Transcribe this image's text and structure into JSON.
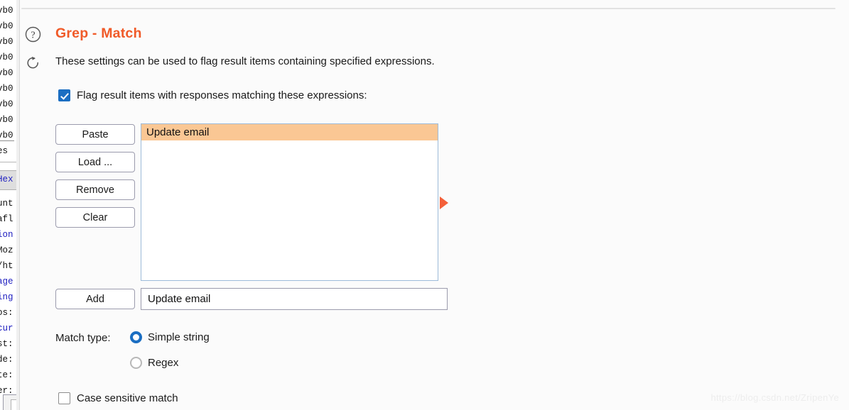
{
  "panel": {
    "title": "Grep - Match",
    "title_color": "#f05a28",
    "description": "These settings can be used to flag result items containing specified expressions.",
    "help_icon": "question-circle-icon",
    "refresh_icon": "refresh-icon"
  },
  "flag_checkbox": {
    "label": "Flag result items with responses matching these expressions:",
    "checked": true
  },
  "buttons": {
    "paste": "Paste",
    "load": "Load ...",
    "remove": "Remove",
    "clear": "Clear",
    "add": "Add"
  },
  "expression_list": {
    "items": [
      {
        "text": "Update email",
        "selected": true
      }
    ],
    "selection_color": "#fac794",
    "border_color": "#9dbbd9"
  },
  "marker": {
    "icon": "triangle-right-icon",
    "color": "#f4603a"
  },
  "add_field": {
    "value": "Update email",
    "placeholder": ""
  },
  "match_type": {
    "label": "Match type:",
    "options": [
      {
        "label": "Simple string",
        "selected": true
      },
      {
        "label": "Regex",
        "selected": false
      }
    ]
  },
  "case_sensitive": {
    "label": "Case sensitive match",
    "checked": false
  },
  "watermark": {
    "text": "https://blog.csdn.net/ZripenYe"
  },
  "left_strip": {
    "hex_rows": [
      "vb0",
      "vb0",
      "vb0",
      "vb0",
      "vb0",
      "vb0",
      "vb0",
      "vb0",
      "vb0"
    ],
    "tabs_fragment": "es",
    "hex_tab": "Hex",
    "header_fragments": [
      "unt",
      "afl",
      "ion",
      "Moz",
      "/ht",
      "age",
      "ing",
      "os:",
      "cur",
      "st:",
      "de:",
      "te:",
      "er:"
    ]
  }
}
